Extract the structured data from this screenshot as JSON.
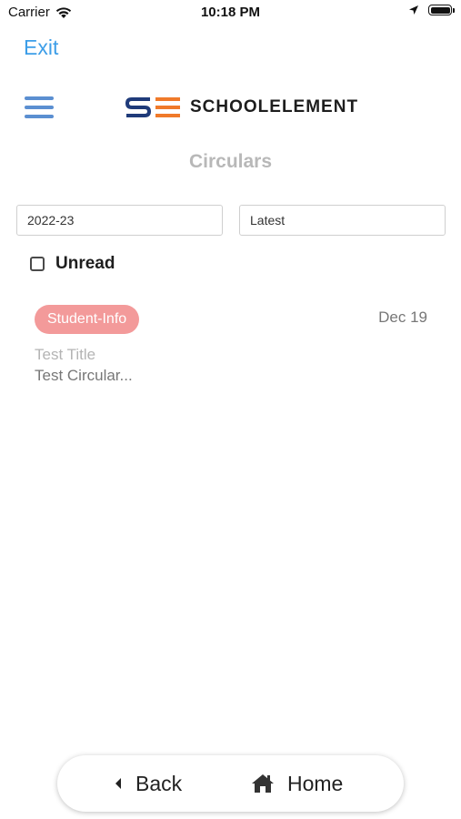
{
  "status_bar": {
    "carrier": "Carrier",
    "time": "10:18 PM",
    "battery_level": 1.0
  },
  "exit_label": "Exit",
  "brand": {
    "name": "SCHOOLELEMENT",
    "logo_letters": "SE",
    "colors": {
      "s": "#1f3b7a",
      "e": "#f07a2a"
    }
  },
  "page_title": "Circulars",
  "filters": {
    "year": "2022-23",
    "sort": "Latest"
  },
  "unread": {
    "label": "Unread",
    "checked": false
  },
  "circulars": [
    {
      "category": "Student-Info",
      "date": "Dec 19",
      "title": "Test Title",
      "snippet": "Test Circular..."
    }
  ],
  "bottom_nav": {
    "back_label": "Back",
    "home_label": "Home"
  },
  "colors": {
    "accent": "#3d9ee8",
    "badge": "#f39a9a",
    "menu_icon": "#5b8fd1"
  },
  "icons": [
    "wifi-icon",
    "location-arrow-icon",
    "battery-icon",
    "hamburger-menu-icon",
    "back-caret-icon",
    "home-icon"
  ]
}
